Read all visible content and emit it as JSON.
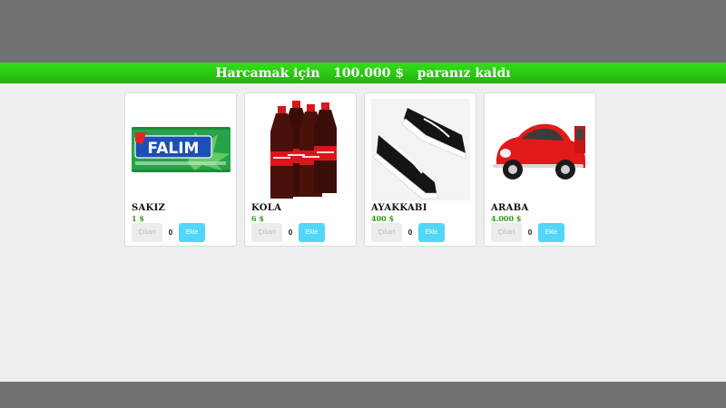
{
  "banner": {
    "prefix": "Harcamak için",
    "amount": "100.000 $",
    "suffix": "paranız kaldı"
  },
  "colors": {
    "banner_green": "#2ed515",
    "price_green": "#2f9a12",
    "buy_button": "#51d7f7",
    "sell_button": "#ececec"
  },
  "products": [
    {
      "name": "SAKIZ",
      "price": "1 $",
      "quantity": "0",
      "sell_label": "Çıkart",
      "buy_label": "Ekle",
      "image": "falim-gum-image",
      "image_text": "FALIM"
    },
    {
      "name": "KOLA",
      "price": "6 $",
      "quantity": "0",
      "sell_label": "Çıkart",
      "buy_label": "Ekle",
      "image": "cola-bottles-image"
    },
    {
      "name": "AYAKKABI",
      "price": "400 $",
      "quantity": "0",
      "sell_label": "Çıkart",
      "buy_label": "Ekle",
      "image": "sneakers-image"
    },
    {
      "name": "ARABA",
      "price": "4.000 $",
      "quantity": "0",
      "sell_label": "Çıkart",
      "buy_label": "Ekle",
      "image": "red-beetle-car-image"
    }
  ]
}
